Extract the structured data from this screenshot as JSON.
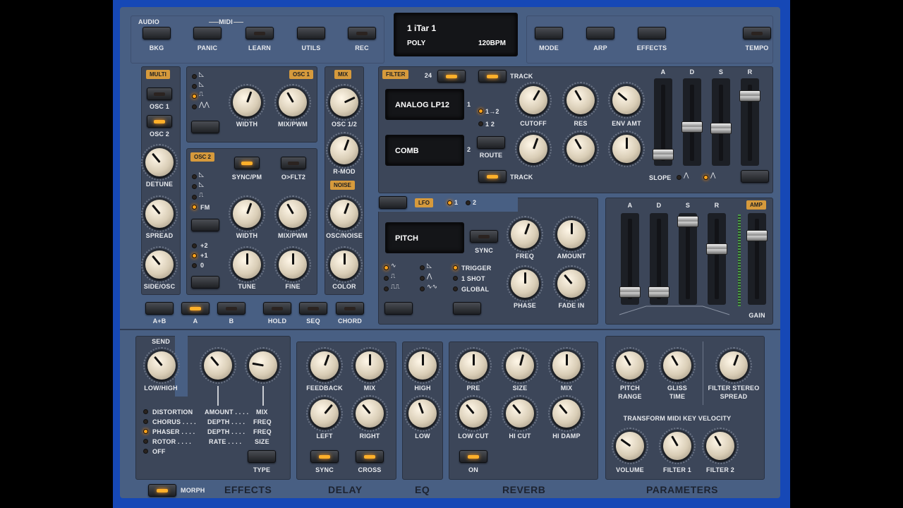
{
  "top": {
    "audio_label": "AUDIO",
    "midi_label": "MIDI",
    "buttons": [
      "BKG",
      "PANIC",
      "LEARN",
      "UTILS",
      "REC",
      "MODE",
      "ARP",
      "EFFECTS",
      "TEMPO"
    ],
    "display": {
      "preset": "1 iTar 1",
      "mode": "POLY",
      "tempo": "120BPM"
    }
  },
  "multi": {
    "tag": "MULTI",
    "osc1": "OSC 1",
    "osc2": "OSC 2",
    "knobs": [
      "DETUNE",
      "SPREAD",
      "SIDE/OSC"
    ]
  },
  "osc1": {
    "tag": "OSC 1",
    "knobs": [
      "WIDTH",
      "MIX/PWM"
    ]
  },
  "osc2": {
    "tag": "OSC 2",
    "sync": "SYNC/PM",
    "oflt": "O>FLT2",
    "fm": "FM",
    "oct": [
      "+2",
      "+1",
      "0"
    ],
    "knobs": [
      "WIDTH",
      "MIX/PWM",
      "TUNE",
      "FINE"
    ]
  },
  "mix": {
    "tag": "MIX",
    "noise_tag": "NOISE",
    "knobs": [
      "OSC 1/2",
      "R-MOD",
      "OSC/NOISE",
      "COLOR"
    ]
  },
  "voice": {
    "buttons": [
      "A+B",
      "A",
      "B",
      "HOLD",
      "SEQ",
      "CHORD"
    ]
  },
  "filter": {
    "tag": "FILTER",
    "slope_num": "24",
    "track": "TRACK",
    "track2": "TRACK",
    "filter1": "ANALOG LP12",
    "filter2": "COMB",
    "num1": "1",
    "num2": "2",
    "route_a": "1→2",
    "route_b": "1 2",
    "route": "ROUTE",
    "knobs": [
      "CUTOFF",
      "RES",
      "ENV AMT"
    ],
    "env": [
      "A",
      "D",
      "S",
      "R"
    ],
    "slope": "SLOPE"
  },
  "lfo": {
    "tag": "LFO",
    "n1": "1",
    "n2": "2",
    "target": "PITCH",
    "sync": "SYNC",
    "knobs": [
      "FREQ",
      "AMOUNT",
      "PHASE",
      "FADE IN"
    ],
    "modes": [
      "TRIGGER",
      "1 SHOT",
      "GLOBAL"
    ]
  },
  "amp": {
    "tag": "AMP",
    "env": [
      "A",
      "D",
      "S",
      "R"
    ],
    "gain": "GAIN"
  },
  "effects": {
    "send": "SEND",
    "low_high": "LOW/HIGH",
    "rows": [
      [
        "DISTORTION",
        "AMOUNT . . . .",
        "MIX"
      ],
      [
        "CHORUS . . . .",
        "DEPTH . . . .",
        "FREQ"
      ],
      [
        "PHASER . . . .",
        "DEPTH . . . .",
        "FREQ"
      ],
      [
        "ROTOR . . . .",
        "RATE . . . .",
        "SIZE"
      ],
      [
        "OFF",
        "",
        ""
      ]
    ],
    "type": "TYPE",
    "title": "EFFECTS",
    "morph": "MORPH"
  },
  "delay": {
    "knobs": [
      "FEEDBACK",
      "MIX",
      "LEFT",
      "RIGHT"
    ],
    "sync": "SYNC",
    "cross": "CROSS",
    "title": "DELAY"
  },
  "eq": {
    "knobs": [
      "HIGH",
      "LOW"
    ],
    "title": "EQ"
  },
  "reverb": {
    "knobs": [
      "PRE",
      "SIZE",
      "MIX",
      "LOW CUT",
      "HI CUT",
      "HI DAMP"
    ],
    "on": "ON",
    "title": "REVERB"
  },
  "params": {
    "knobs": [
      "PITCH",
      "GLISS",
      "FILTER STEREO"
    ],
    "knobs2": [
      "RANGE",
      "TIME",
      "SPREAD"
    ],
    "transform": "TRANSFORM MIDI KEY VELOCITY",
    "vel": [
      "VOLUME",
      "FILTER 1",
      "FILTER 2"
    ],
    "title": "PARAMETERS"
  },
  "colors": {
    "accent": "#ffb02a",
    "panel": "#3c4659",
    "body": "#485f83",
    "frame": "#1648b6"
  }
}
